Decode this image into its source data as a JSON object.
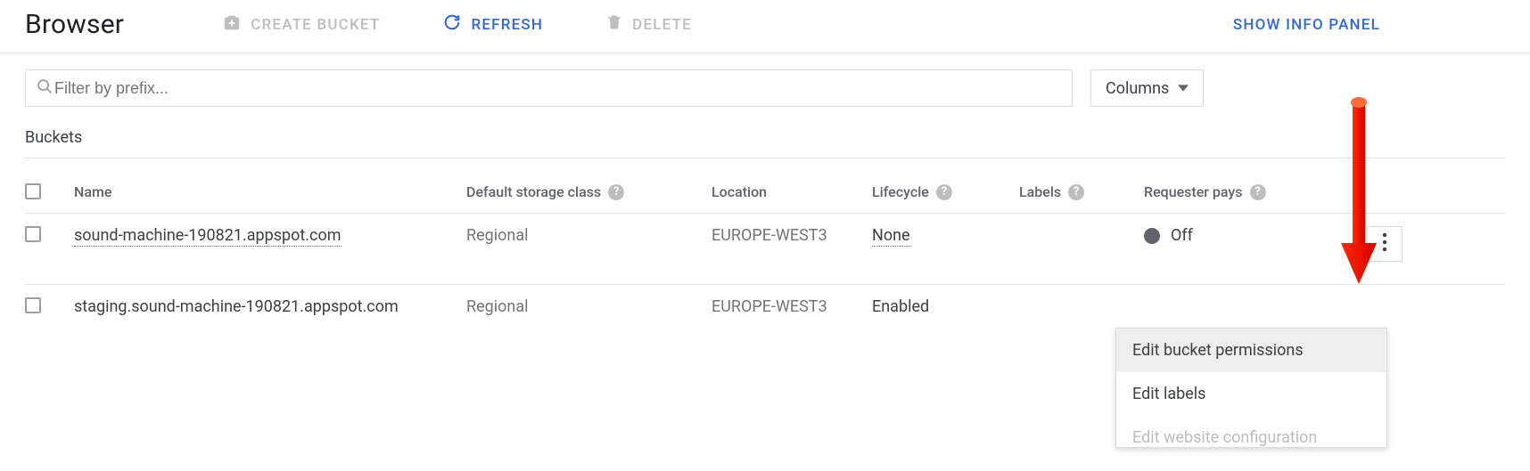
{
  "header": {
    "title": "Browser",
    "create_label": "CREATE BUCKET",
    "refresh_label": "REFRESH",
    "delete_label": "DELETE",
    "info_panel_label": "SHOW INFO PANEL"
  },
  "filter": {
    "placeholder": "Filter by prefix...",
    "value": ""
  },
  "columns_label": "Columns",
  "section_label": "Buckets",
  "table": {
    "headers": {
      "name": "Name",
      "storage_class": "Default storage class",
      "location": "Location",
      "lifecycle": "Lifecycle",
      "labels": "Labels",
      "requester_pays": "Requester pays"
    },
    "rows": [
      {
        "name": "sound-machine-190821.appspot.com",
        "storage_class": "Regional",
        "location": "EUROPE-WEST3",
        "lifecycle": "None",
        "labels": "",
        "requester_pays": "Off",
        "requester_on": false,
        "actions_open": true
      },
      {
        "name": "staging.sound-machine-190821.appspot.com",
        "storage_class": "Regional",
        "location": "EUROPE-WEST3",
        "lifecycle": "Enabled",
        "labels": "",
        "requester_pays": "",
        "requester_on": false,
        "actions_open": false
      }
    ]
  },
  "menu": {
    "items": [
      "Edit bucket permissions",
      "Edit labels",
      "Edit website configuration"
    ],
    "selected_index": 0
  },
  "icons": {
    "help": "?"
  }
}
